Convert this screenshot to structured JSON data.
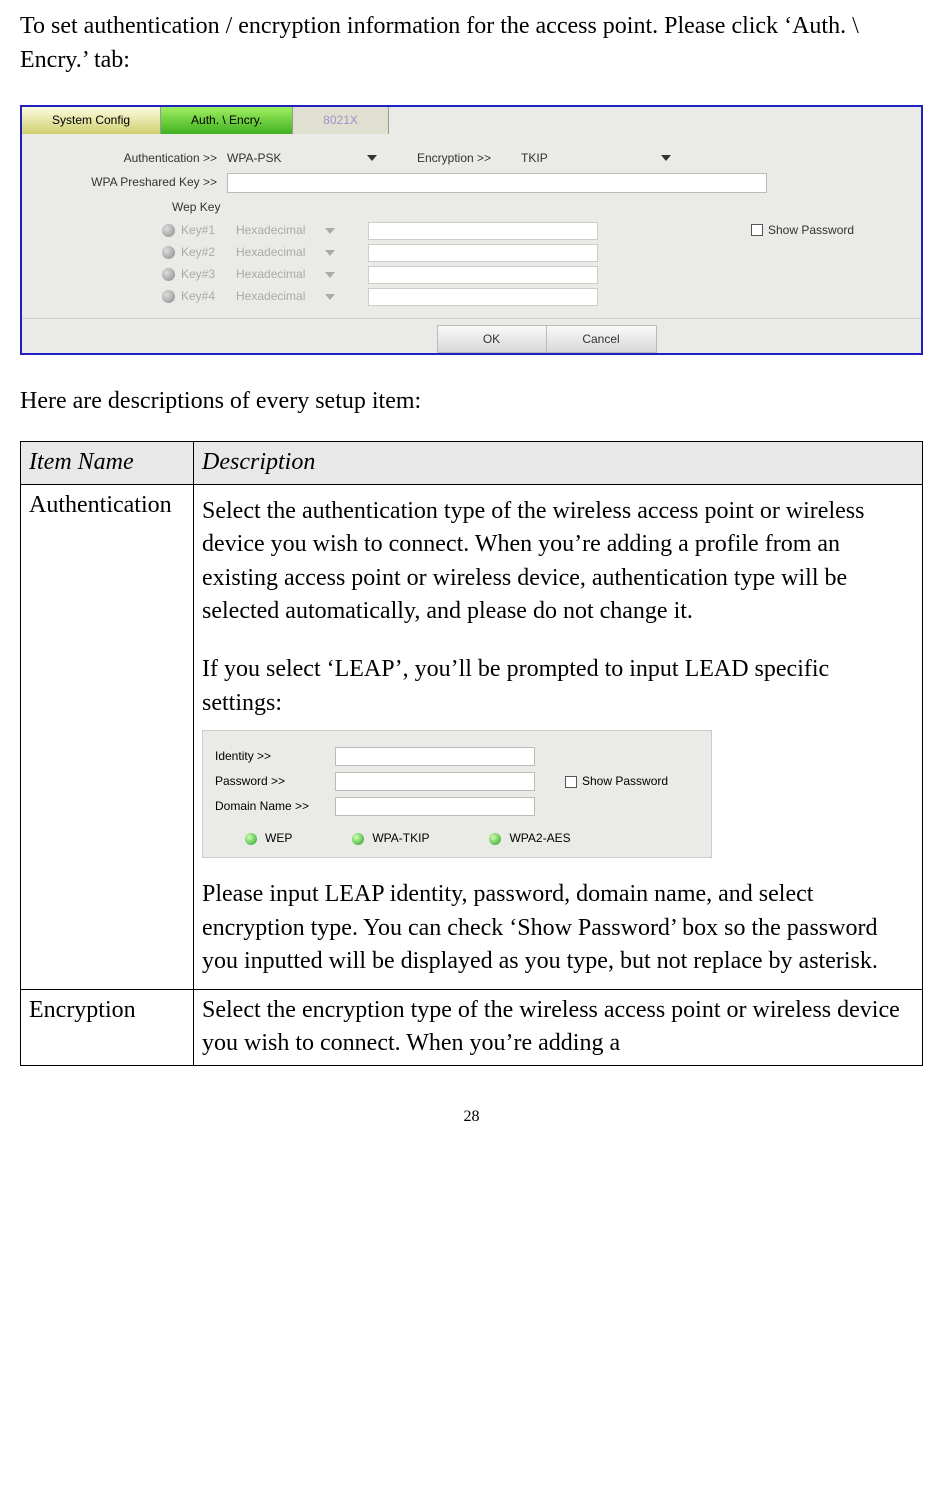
{
  "intro": {
    "p1": "To set authentication / encryption information for the access point. Please click ‘Auth. \\ Encry.’ tab:"
  },
  "panel": {
    "tabs": {
      "system_config": "System Config",
      "auth_encry": "Auth. \\ Encry.",
      "dot1x": "8021X"
    },
    "labels": {
      "authentication": "Authentication >>",
      "encryption": "Encryption >>",
      "wpa_psk": "WPA Preshared Key >>",
      "wep_key": "Wep Key",
      "show_password": "Show Password"
    },
    "values": {
      "authentication": "WPA-PSK",
      "encryption": "TKIP"
    },
    "wep_keys": [
      {
        "label": "Key#1",
        "format": "Hexadecimal"
      },
      {
        "label": "Key#2",
        "format": "Hexadecimal"
      },
      {
        "label": "Key#3",
        "format": "Hexadecimal"
      },
      {
        "label": "Key#4",
        "format": "Hexadecimal"
      }
    ],
    "buttons": {
      "ok": "OK",
      "cancel": "Cancel"
    }
  },
  "mid_text": "Here are descriptions of every setup item:",
  "table": {
    "headers": {
      "item": "Item Name",
      "desc": "Description"
    },
    "rows": {
      "authentication": {
        "name": "Authentication",
        "desc_p1": "Select the authentication type of the wireless access point or wireless device you wish to connect. When you’re adding a profile from an existing access point or wireless device, authentication type will be selected automatically, and please do not change it.",
        "desc_p2": "If you select ‘LEAP’, you’ll be prompted to input LEAD specific settings:",
        "desc_p3": "Please input LEAP identity, password, domain name, and select encryption type. You can check ‘Show Password’ box so the password you inputted will be displayed as you type, but not replace by asterisk."
      },
      "encryption": {
        "name": "Encryption",
        "desc": "Select the encryption type of the wireless access point or wireless device you wish to connect. When you’re adding a"
      }
    }
  },
  "leap": {
    "identity": "Identity >>",
    "password": "Password >>",
    "domain": "Domain Name >>",
    "show_password": "Show Password",
    "status": {
      "wep": "WEP",
      "wpa_tkip": "WPA-TKIP",
      "wpa2_aes": "WPA2-AES"
    }
  },
  "page_number": "28"
}
